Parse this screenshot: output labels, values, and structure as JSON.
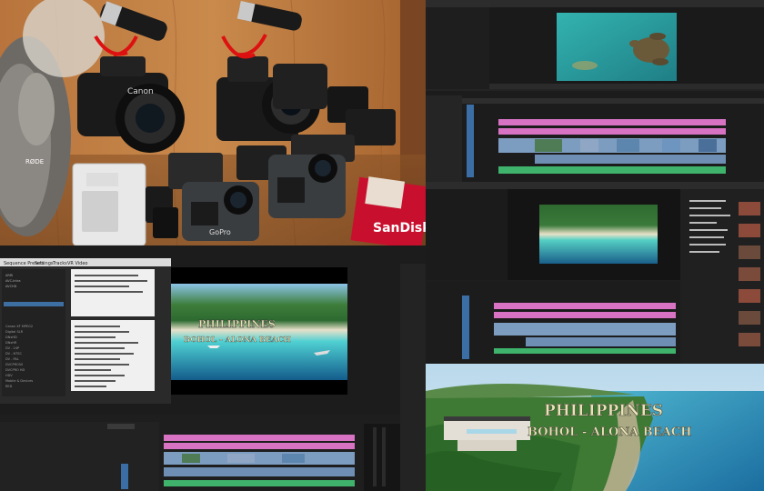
{
  "photo": {
    "brand_mic": "RØDE",
    "camera_brand": "Canon",
    "gopro_brand": "GoPro",
    "sd_card_brand": "SanDisk"
  },
  "editor_bottom_left": {
    "dialog_tabs": [
      "Sequence Presets",
      "Settings",
      "Tracks",
      "VR Video"
    ],
    "preset_items": [
      "ARRI",
      "AVC-Intra",
      "AVCHD",
      "Canon XF MPEG2",
      "Digital SLR",
      "DNxHD",
      "DNxHR",
      "DV - 24P",
      "DV - NTSC",
      "DV - PAL",
      "DVCPRO50",
      "DVCPRO HD",
      "HDV",
      "Mobile & Devices",
      "RED",
      "XDCAM EX",
      "XDCAM HD",
      "XDCAM HD422"
    ]
  },
  "video_title": {
    "line1": "PHILIPPINES",
    "line2": "BOHOL - ALONA BEACH"
  },
  "colors": {
    "pink_clip": "#d873c4",
    "blue_clip": "#7d9dc0",
    "green_audio": "#3fb26b",
    "panel_dark": "#222222",
    "title_color": "#e9e3b8"
  }
}
